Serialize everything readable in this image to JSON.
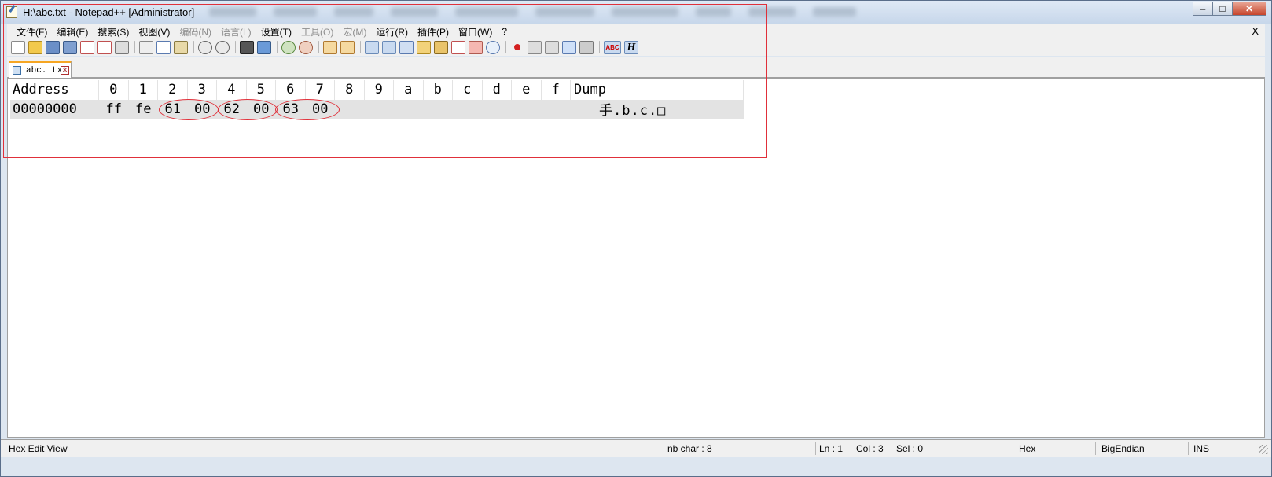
{
  "window": {
    "title": "H:\\abc.txt - Notepad++ [Administrator]",
    "buttons": {
      "minimize": "–",
      "maximize": "□",
      "close": "✕"
    }
  },
  "menu": {
    "items": [
      {
        "label": "文件(F)",
        "enabled": true
      },
      {
        "label": "编辑(E)",
        "enabled": true
      },
      {
        "label": "搜索(S)",
        "enabled": true
      },
      {
        "label": "视图(V)",
        "enabled": true
      },
      {
        "label": "编码(N)",
        "enabled": false
      },
      {
        "label": "语言(L)",
        "enabled": false
      },
      {
        "label": "设置(T)",
        "enabled": true
      },
      {
        "label": "工具(O)",
        "enabled": false
      },
      {
        "label": "宏(M)",
        "enabled": false
      },
      {
        "label": "运行(R)",
        "enabled": true
      },
      {
        "label": "插件(P)",
        "enabled": true
      },
      {
        "label": "窗口(W)",
        "enabled": true
      },
      {
        "label": "?",
        "enabled": true
      }
    ],
    "close": "X"
  },
  "toolbar": {
    "icons": [
      "new-file-icon",
      "open-file-icon",
      "save-icon",
      "save-all-icon",
      "close-icon",
      "close-all-icon",
      "print-icon",
      "|",
      "cut-icon",
      "copy-icon",
      "paste-icon",
      "|",
      "undo-icon",
      "redo-icon",
      "|",
      "find-icon",
      "replace-icon",
      "|",
      "zoom-in-icon",
      "zoom-out-icon",
      "|",
      "sync-vertical-icon",
      "sync-horizontal-icon",
      "|",
      "word-wrap-icon",
      "show-all-chars-icon",
      "indent-guide-icon",
      "user-lang-icon",
      "doc-map-icon",
      "function-list-icon",
      "folder-workspace-icon",
      "monitor-icon",
      "|",
      "record-macro-icon",
      "stop-macro-icon",
      "play-macro-icon",
      "run-macro-multiple-icon",
      "save-macro-icon",
      "|",
      "spell-check-icon",
      "hex-editor-icon"
    ],
    "spell_label": "ABC",
    "hex_label": "H"
  },
  "tabs": [
    {
      "label": "abc. txt"
    }
  ],
  "hex": {
    "address_header": "Address",
    "columns": [
      "0",
      "1",
      "2",
      "3",
      "4",
      "5",
      "6",
      "7",
      "8",
      "9",
      "a",
      "b",
      "c",
      "d",
      "e",
      "f"
    ],
    "dump_header": "Dump",
    "rows": [
      {
        "address": "00000000",
        "bytes": [
          "ff",
          "fe",
          "61",
          "00",
          "62",
          "00",
          "63",
          "00",
          "",
          "",
          "",
          "",
          "",
          "",
          "",
          ""
        ],
        "dump": "手.b.c.□"
      }
    ]
  },
  "status": {
    "mode": "Hex Edit View",
    "nb_char": "nb char : 8",
    "ln": "Ln : 1",
    "col": "Col : 3",
    "sel": "Sel : 0",
    "view": "Hex",
    "endian": "BigEndian",
    "ins": "INS"
  },
  "colors": {
    "annotation": "#e0303a",
    "tab_accent": "#f6a623",
    "row_highlight": "#e3e3e3"
  }
}
